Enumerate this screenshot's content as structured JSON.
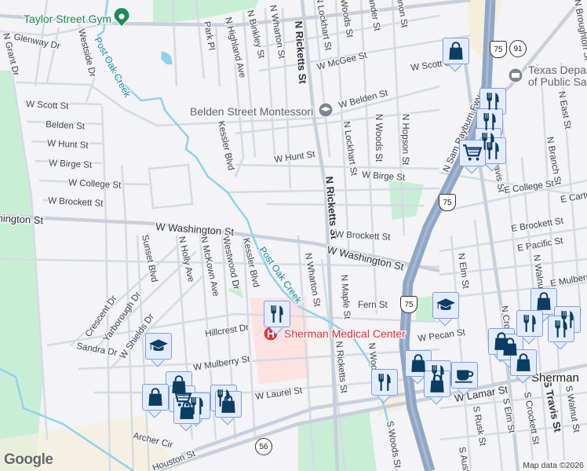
{
  "places": {
    "gym": "Taylor Street Gym",
    "school": "Belden Street Montessori",
    "dps_line1": "Texas Department",
    "dps_line2": "of Public Safety",
    "hospital": "Sherman Medical Center",
    "city": "Sherman"
  },
  "waterways": {
    "creek": "Post Oak Creek"
  },
  "streets": {
    "glenway": "Glenway Dr",
    "grant": "N Grant Dr",
    "westside": "Westside Dr",
    "park": "Park Pl",
    "highland": "N Highland Ave",
    "binkley": "N Binkley St",
    "wharton": "N Wharton St",
    "ricketts": "N Ricketts St",
    "lockhart": "N Lockhart St",
    "woods": "N Woods St",
    "alexander": "Alexander St",
    "cannon": "Cannon St",
    "mcgee": "W McGee St",
    "scott": "W Scott St",
    "belden": "Belden St",
    "wbelden": "W Belden St",
    "hunt": "W Hunt St",
    "birge": "W Birge St",
    "college": "W College St",
    "brockett": "W Brockett St",
    "washington": "W Washington St",
    "hopson": "N Hopson St",
    "kessler": "Kessler Blvd",
    "rayburn": "N Sam Rayburn Fwy",
    "ntravis": "N Travis St",
    "broughton": "N Broughton St",
    "east": "N East St",
    "branch": "N Branch St",
    "ecollege": "E College St",
    "ecarter": "E Carter St",
    "ebrockett": "E Brockett St",
    "epacific": "E Pacific St",
    "emulberry": "E Mulberry St",
    "nelm": "N Elm St",
    "nwalnut": "N Walnut St",
    "ncrockett": "N Crockett St",
    "sunset": "Sunset Blvd",
    "holly": "N Holly Ave",
    "mckown": "N McKown Ave",
    "westwood": "Westwood Dr",
    "maple": "N Maple St",
    "fern": "Fern St",
    "crescent": "Crescent Dr",
    "yarborough": "Yarborough Dr",
    "shields": "W Shields Dr",
    "sandra": "Sandra Dr",
    "hillcrest": "Hillcrest Dr",
    "mulberry": "W Mulberry St",
    "laurel": "W Laurel St",
    "archer": "Archer Cir",
    "houston": "Houston St",
    "pecan": "W Pecan St",
    "lamar": "W Lamar St",
    "swoods": "S Woods St",
    "rusk": "S Rusk St",
    "selm": "S Elm St",
    "scrockett": "S Crockett St",
    "stravis": "S Travis St",
    "swalnut": "S Walnut St",
    "saustin": "S Austin St"
  },
  "shields": {
    "us75": "75",
    "sh91": "91",
    "sh56": "56"
  },
  "attribution": "Map data ©2026",
  "logo": "Google",
  "colors": {
    "marker_fill": "#e4ecfc",
    "marker_border": "#7d9ee0",
    "icon": "#0b3d63",
    "park": "#c9eed6",
    "highway": "#8fa6c6",
    "creek": "#8fd3ea",
    "hospital": "#e8323c",
    "poi_green": "#1e8a5a"
  }
}
